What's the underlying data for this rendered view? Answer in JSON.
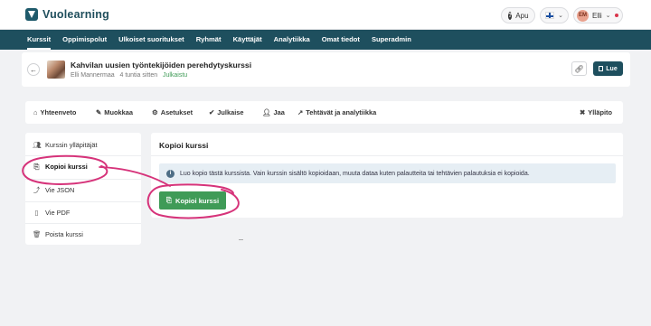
{
  "app": {
    "logo_text": "Vuolearning",
    "help_label": "Apu",
    "user_initials": "EM",
    "user_name": "Elli"
  },
  "nav": {
    "items": [
      {
        "label": "Kurssit",
        "active": true
      },
      {
        "label": "Oppimispolut"
      },
      {
        "label": "Ulkoiset suoritukset"
      },
      {
        "label": "Ryhmät"
      },
      {
        "label": "Käyttäjät"
      },
      {
        "label": "Analytiikka"
      },
      {
        "label": "Omat tiedot"
      },
      {
        "label": "Superadmin"
      }
    ]
  },
  "course": {
    "title": "Kahvilan uusien työntekijöiden perehdytyskurssi",
    "author": "Elli Mannermaa",
    "time": "4 tuntia sitten",
    "status": "Julkaistu",
    "read_label": "Lue"
  },
  "tabs": [
    {
      "label": "Yhteenveto",
      "icon": "home-icon"
    },
    {
      "label": "Muokkaa",
      "icon": "pencil-icon"
    },
    {
      "label": "Asetukset",
      "icon": "gear-icon"
    },
    {
      "label": "Julkaise",
      "icon": "check-circle-icon"
    },
    {
      "label": "Jaa",
      "icon": "person-icon"
    },
    {
      "label": "Tehtävät ja analytiikka",
      "icon": "chart-icon"
    },
    {
      "label": "Ylläpito",
      "icon": "tools-icon"
    }
  ],
  "sidebar": {
    "items": [
      {
        "label": "Kurssin ylläpitäjät",
        "icon": "users-icon"
      },
      {
        "label": "Kopioi kurssi",
        "icon": "copy-icon",
        "active": true
      },
      {
        "label": "Vie JSON",
        "icon": "export-icon"
      },
      {
        "label": "Vie PDF",
        "icon": "file-icon"
      },
      {
        "label": "Poista kurssi",
        "icon": "trash-icon"
      }
    ]
  },
  "main": {
    "title": "Kopioi kurssi",
    "info_text": "Luo kopio tästä kurssista. Vain kurssin sisältö kopioidaan, muuta dataa kuten palautteita tai tehtävien palautuksia ei kopioida.",
    "copy_button_label": "Kopioi kurssi"
  },
  "colors": {
    "brand": "#1e4f5e",
    "success": "#3f9b57",
    "annotation": "#d6337a"
  }
}
